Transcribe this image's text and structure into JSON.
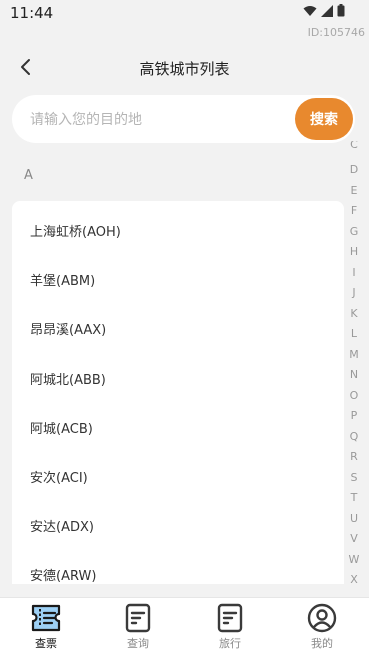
{
  "status": {
    "time": "11:44",
    "id": "ID:105746"
  },
  "nav": {
    "title": "高铁城市列表"
  },
  "search": {
    "placeholder": "请输入您的目的地",
    "button": "搜索"
  },
  "section": {
    "header": "A"
  },
  "cities": [
    "上海虹桥(AOH)",
    "羊堡(ABM)",
    "昂昂溪(AAX)",
    "阿城北(ABB)",
    "阿城(ACB)",
    "安次(ACI)",
    "安达(ADX)",
    "安德(ARW)"
  ],
  "index_letters": [
    "C",
    "D",
    "E",
    "F",
    "G",
    "H",
    "I",
    "J",
    "K",
    "L",
    "M",
    "N",
    "O",
    "P",
    "Q",
    "R",
    "S",
    "T",
    "U",
    "V",
    "W",
    "X"
  ],
  "tabs": [
    {
      "label": "查票",
      "icon": "ticket-icon",
      "active": true
    },
    {
      "label": "查询",
      "icon": "document-icon",
      "active": false
    },
    {
      "label": "旅行",
      "icon": "document-icon",
      "active": false
    },
    {
      "label": "我的",
      "icon": "user-icon",
      "active": false
    }
  ],
  "colors": {
    "accent": "#e8892e",
    "active_tab": "#111111",
    "inactive_tab": "#888888",
    "icon_dark": "#3a3a3a",
    "ticket_blue": "#9dd0f5"
  }
}
